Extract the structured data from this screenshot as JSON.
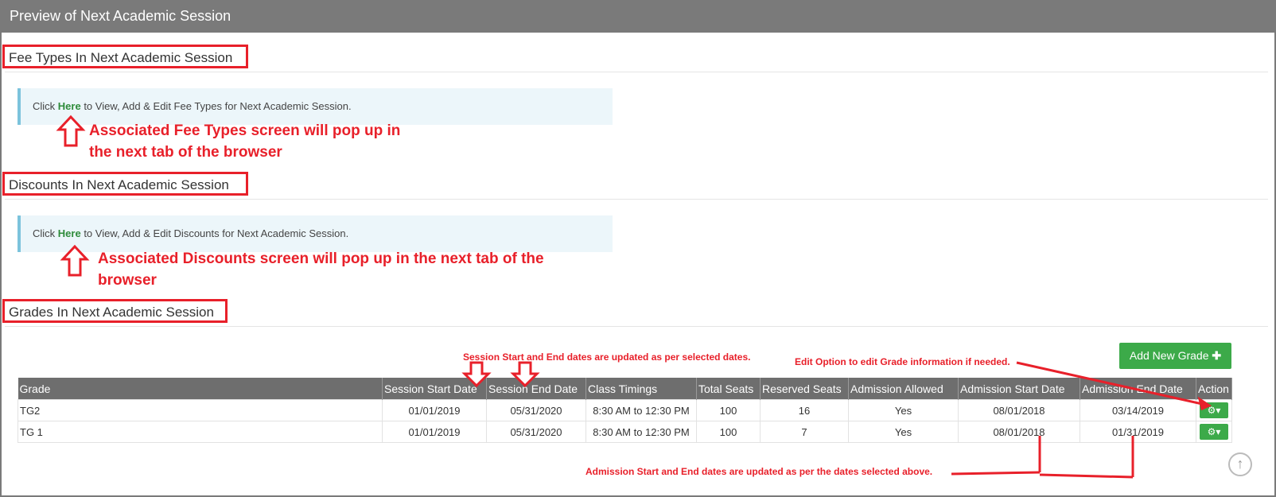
{
  "panel": {
    "title": "Preview of Next Academic Session"
  },
  "fee_types": {
    "title": "Fee Types In Next Academic Session",
    "info_prefix": "Click ",
    "info_link": "Here",
    "info_suffix": " to View, Add & Edit Fee Types for Next Academic Session.",
    "note_line1": "Associated Fee Types screen will pop up in",
    "note_line2": "the next tab of the browser"
  },
  "discounts": {
    "title": "Discounts In Next Academic Session",
    "info_prefix": "Click ",
    "info_link": "Here",
    "info_suffix": " to View, Add & Edit Discounts for Next Academic Session.",
    "note_line1": "Associated Discounts screen will pop up in the next tab of the",
    "note_line2": "browser"
  },
  "grades": {
    "title": "Grades In Next Academic Session",
    "add_button": "Add New Grade",
    "add_icon": "plus-icon",
    "columns": [
      "Grade",
      "Session Start Date",
      "Session End Date",
      "Class Timings",
      "Total Seats",
      "Reserved Seats",
      "Admission Allowed",
      "Admission Start Date",
      "Admission End Date",
      "Action"
    ],
    "rows": [
      {
        "grade": "TG2",
        "session_start": "01/01/2019",
        "session_end": "05/31/2020",
        "timings": "8:30 AM to 12:30 PM",
        "total_seats": "100",
        "reserved_seats": "16",
        "admission_allowed": "Yes",
        "admission_start": "08/01/2018",
        "admission_end": "03/14/2019",
        "action_icon": "gears-icon"
      },
      {
        "grade": "TG 1",
        "session_start": "01/01/2019",
        "session_end": "05/31/2020",
        "timings": "8:30 AM to 12:30 PM",
        "total_seats": "100",
        "reserved_seats": "7",
        "admission_allowed": "Yes",
        "admission_start": "08/01/2018",
        "admission_end": "01/31/2019",
        "action_icon": "gears-icon"
      }
    ]
  },
  "annotations": {
    "session_dates": "Session Start and End dates are updated as per selected dates.",
    "edit_option": "Edit Option to edit Grade information if needed.",
    "admission_dates": "Admission Start and End dates are updated as per the dates selected above."
  },
  "colors": {
    "annotation_red": "#e8202a",
    "header_gray": "#7a7a7a",
    "button_green": "#3caa49"
  }
}
